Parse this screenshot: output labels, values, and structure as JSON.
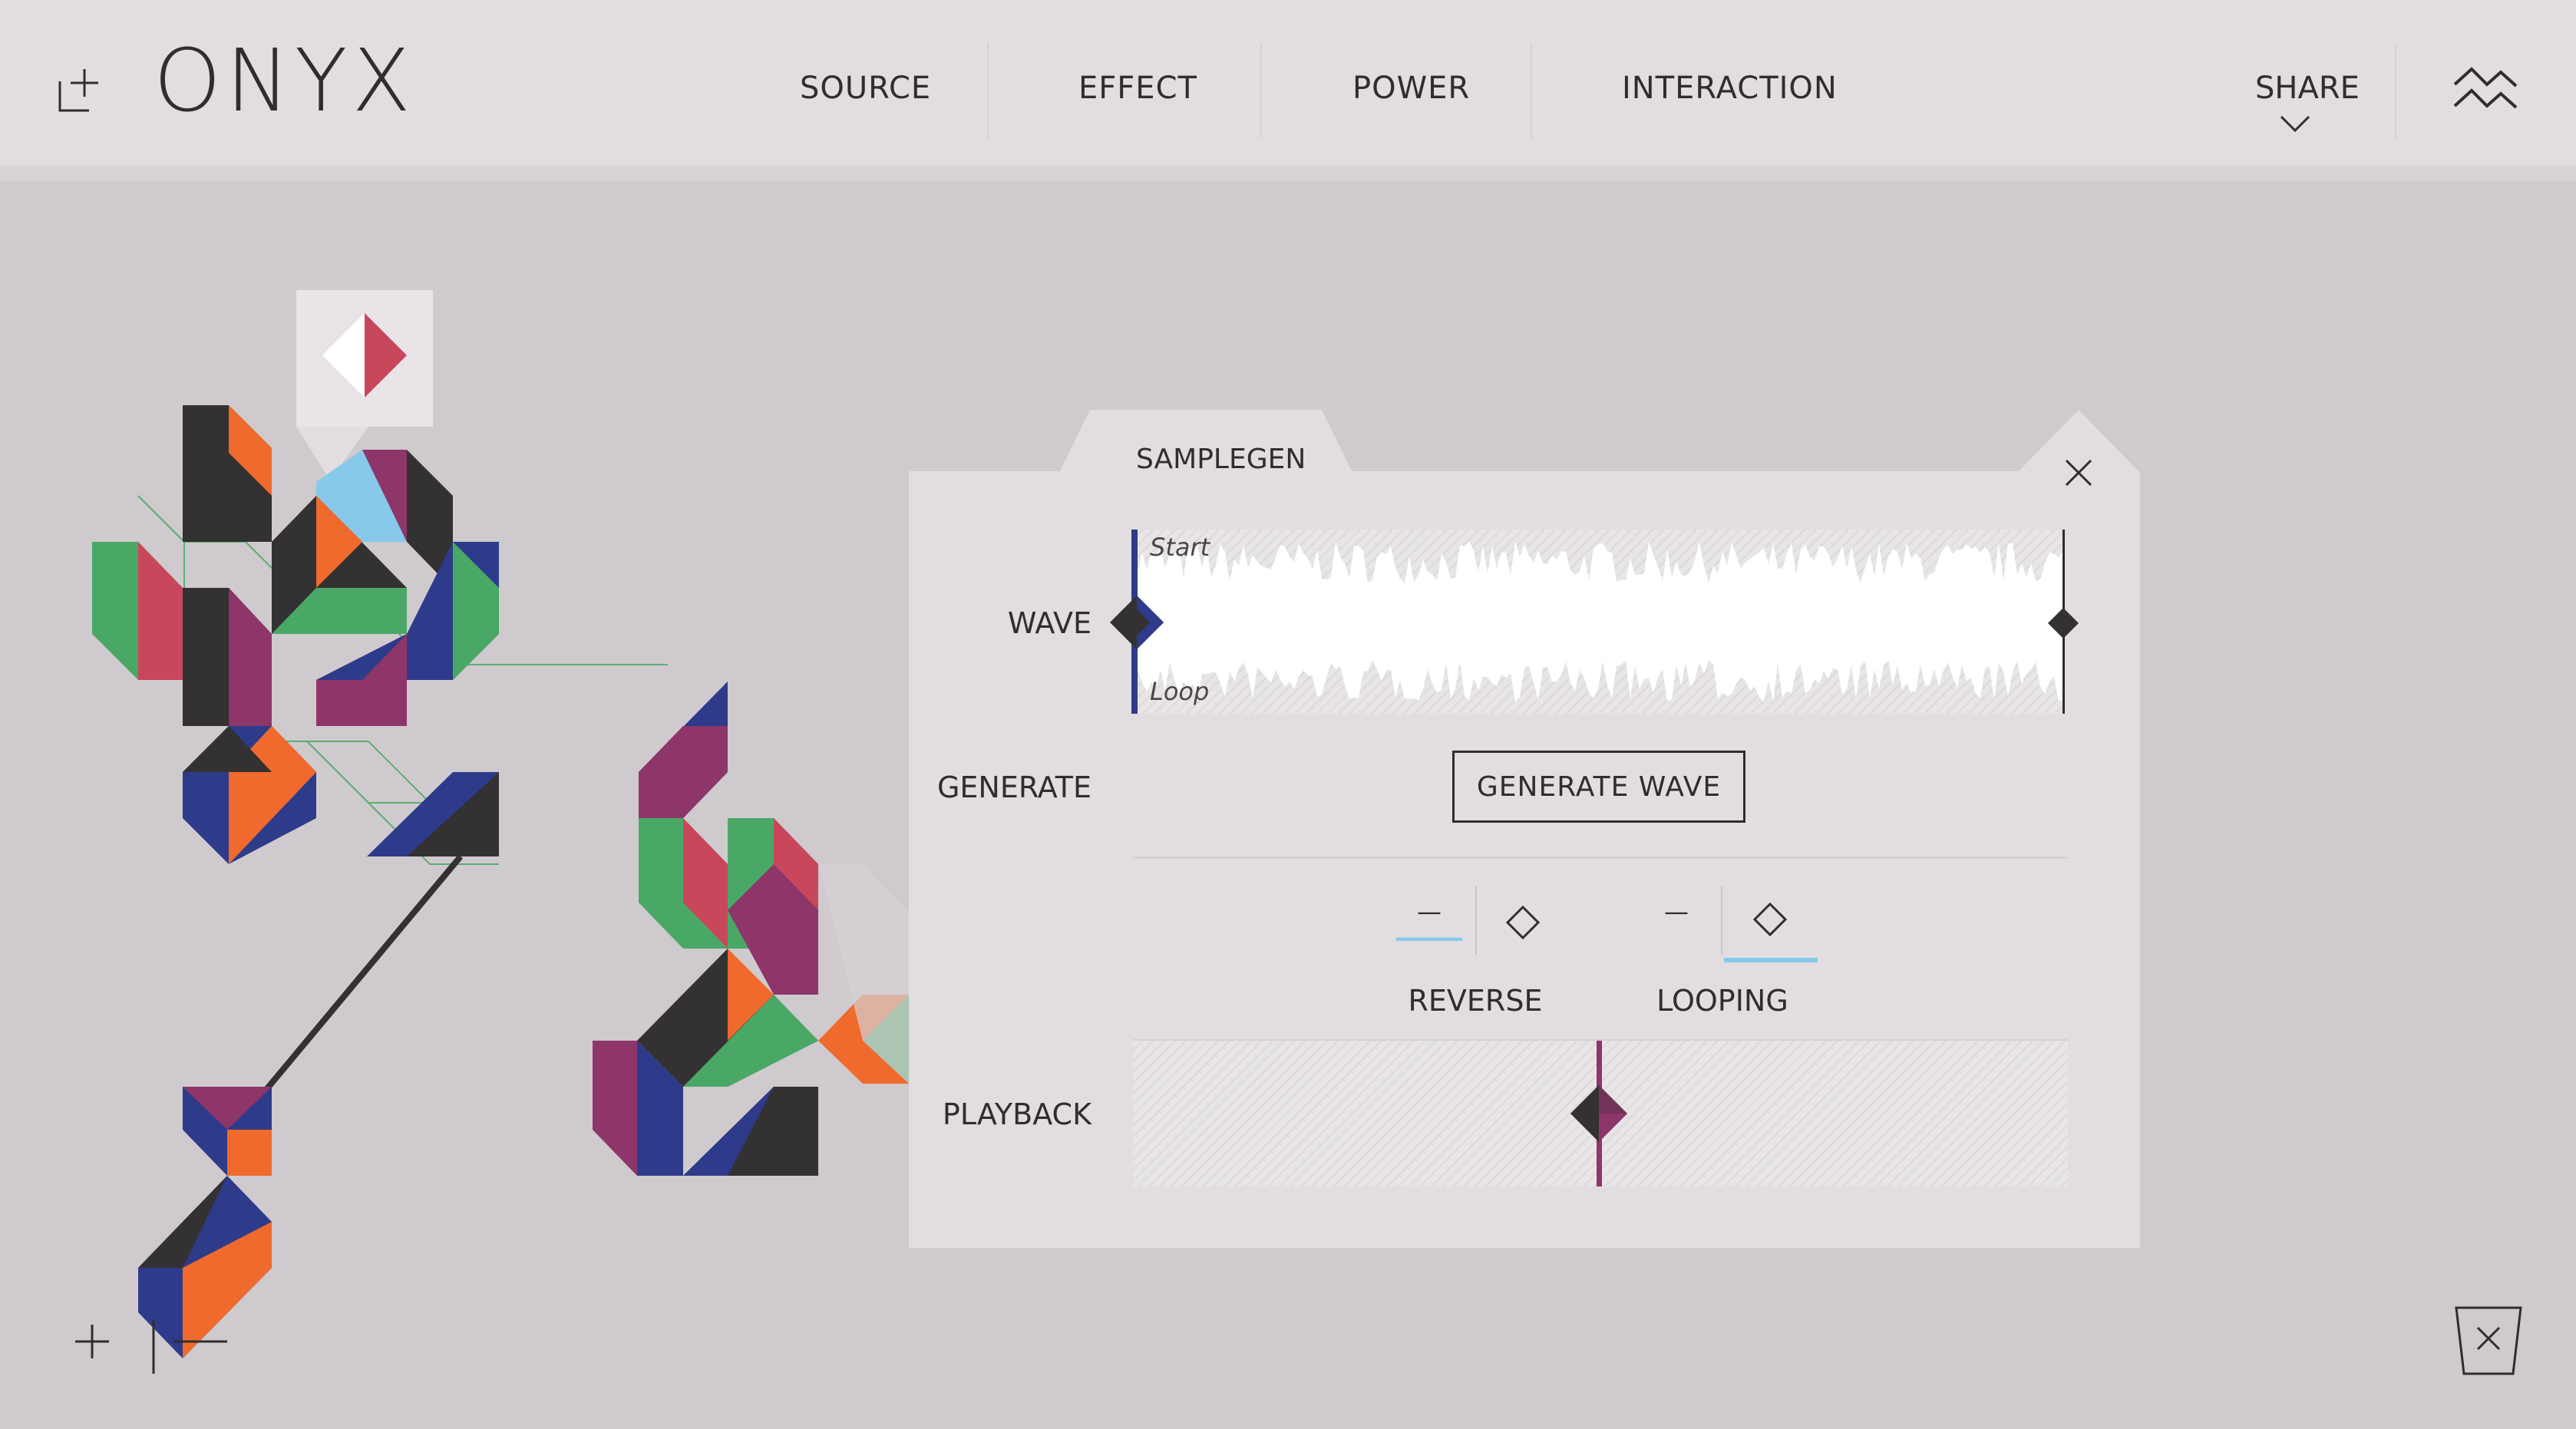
{
  "app": {
    "title": "ONYX"
  },
  "nav": {
    "items": [
      {
        "label": "SOURCE"
      },
      {
        "label": "EFFECT"
      },
      {
        "label": "POWER"
      },
      {
        "label": "INTERACTION"
      }
    ],
    "share_label": "SHARE"
  },
  "panel": {
    "title": "SAMPLEGEN",
    "wave": {
      "label": "WAVE",
      "start_label": "Start",
      "loop_label": "Loop"
    },
    "generate": {
      "label": "GENERATE",
      "button_label": "GENERATE WAVE"
    },
    "toggles": [
      {
        "label": "REVERSE",
        "state": "off"
      },
      {
        "label": "LOOPING",
        "state": "on"
      }
    ],
    "playback": {
      "label": "PLAYBACK",
      "position": 0.5
    }
  },
  "colors": {
    "accent_blue": "#2e3b8a",
    "accent_purple": "#8e3569",
    "toggle_indicator": "#86c9ea",
    "red": "#c8475a",
    "orange": "#ef6a2c",
    "green": "#4aa866",
    "dark": "#333131"
  },
  "icons": {
    "brand": "add-node-icon",
    "menu": "wave-menu-icon",
    "close": "close-icon",
    "trash": "trash-icon",
    "zoom_in": "plus-icon",
    "zoom_out": "minus-icon"
  }
}
